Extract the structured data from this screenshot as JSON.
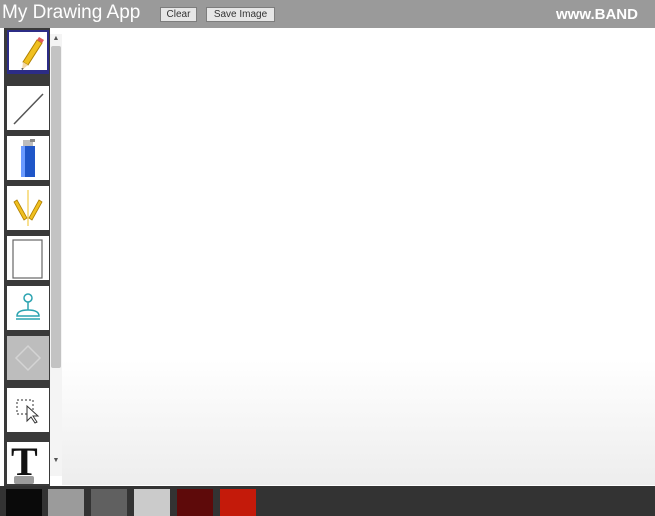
{
  "header": {
    "title": "My Drawing App",
    "clear_label": "Clear",
    "save_label": "Save Image",
    "brand_text": "www.BAND"
  },
  "tools": [
    {
      "name": "pencil",
      "icon": "pencil-icon",
      "selected": true
    },
    {
      "name": "line",
      "icon": "line-icon"
    },
    {
      "name": "spray",
      "icon": "spray-can-icon"
    },
    {
      "name": "symmetry-brush",
      "icon": "symmetry-pencils-icon"
    },
    {
      "name": "rectangle",
      "icon": "rectangle-icon"
    },
    {
      "name": "stamp",
      "icon": "stamp-icon"
    },
    {
      "name": "shape",
      "icon": "diamond-icon",
      "disabled": true
    },
    {
      "name": "select",
      "icon": "selection-cursor-icon"
    },
    {
      "name": "text",
      "icon": "text-icon",
      "glyph": "T"
    }
  ],
  "palette": {
    "colors": [
      "#0a0a0a",
      "#9b9b9b",
      "#606060",
      "#cbcbcb",
      "#5e0a0a",
      "#c41a0a"
    ]
  },
  "colors": {
    "header_bg": "#9a9a9a",
    "palette_bg": "#333333",
    "tool_strip_bg": "#3a3a3a",
    "selected_border": "#2c2c86"
  }
}
